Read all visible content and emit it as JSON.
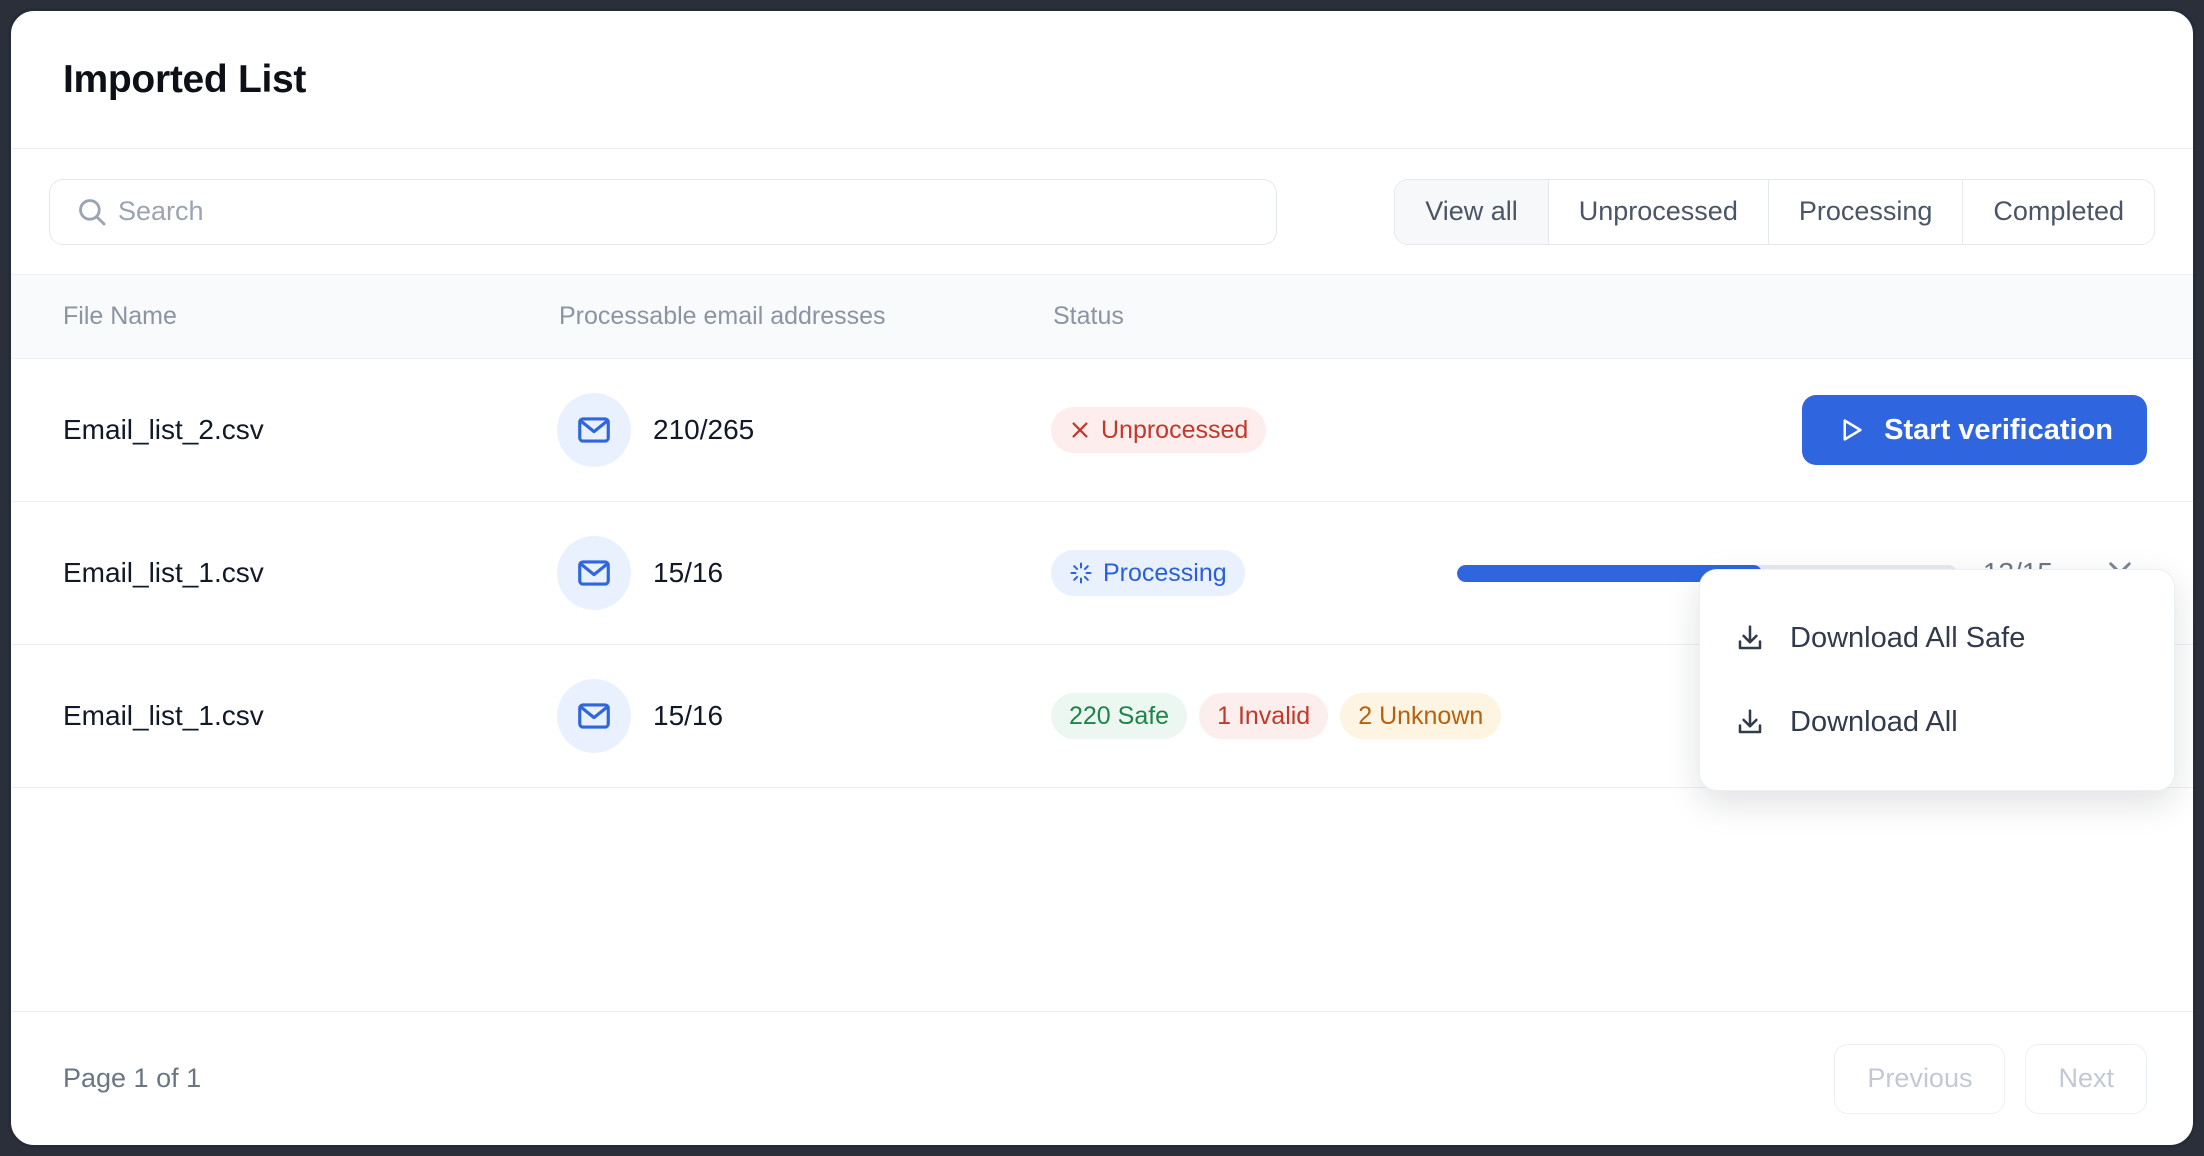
{
  "header": {
    "title": "Imported List"
  },
  "toolbar": {
    "search": {
      "placeholder": "Search",
      "value": "",
      "icon": "search-icon"
    },
    "tabs": [
      {
        "label": "View all",
        "active": true
      },
      {
        "label": "Unprocessed",
        "active": false
      },
      {
        "label": "Processing",
        "active": false
      },
      {
        "label": "Completed",
        "active": false
      }
    ]
  },
  "table": {
    "columns": [
      "File Name",
      "Processable email addresses",
      "Status"
    ],
    "rows": [
      {
        "file_name": "Email_list_2.csv",
        "icon": "mail-icon",
        "processable": "210/265",
        "status_kind": "unprocessed",
        "status_badges": [
          {
            "label": "Unprocessed",
            "icon": "close-x-icon",
            "color": "#c0392b",
            "bg": "#fdeeed"
          }
        ],
        "action": {
          "kind": "button",
          "label": "Start verification",
          "icon": "play-icon",
          "color": "#2f66e0"
        }
      },
      {
        "file_name": "Email_list_1.csv",
        "icon": "mail-icon",
        "processable": "15/16",
        "status_kind": "processing",
        "status_badges": [
          {
            "label": "Processing",
            "icon": "spinner-icon",
            "color": "#2b5fd9",
            "bg": "#eaf1fe"
          }
        ],
        "action": {
          "kind": "progress",
          "progress_label": "13/15",
          "progress_percent": 61,
          "cancel_icon": "close-x-icon",
          "color": "#2f66e0"
        }
      },
      {
        "file_name": "Email_list_1.csv",
        "icon": "mail-icon",
        "processable": "15/16",
        "status_kind": "completed",
        "status_badges": [
          {
            "label": "220 Safe",
            "icon": "",
            "color": "#1e8449",
            "bg": "#edf7f1"
          },
          {
            "label": "1 Invalid",
            "icon": "",
            "color": "#c0392b",
            "bg": "#fdeeee"
          },
          {
            "label": "2 Unknown",
            "icon": "",
            "color": "#b9600f",
            "bg": "#fdf5e2"
          }
        ],
        "action": {
          "kind": "download",
          "icon": "download-icon"
        }
      }
    ]
  },
  "dropdown": {
    "open": true,
    "items": [
      {
        "label": "Download All Safe",
        "icon": "download-icon"
      },
      {
        "label": "Download All",
        "icon": "download-icon"
      }
    ]
  },
  "footer": {
    "page_indicator": "Page 1 of 1",
    "previous_label": "Previous",
    "next_label": "Next"
  }
}
